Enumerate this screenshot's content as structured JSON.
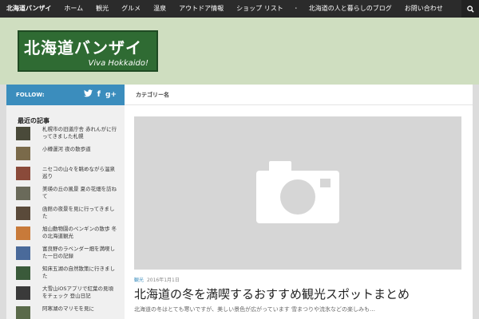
{
  "topnav": {
    "items": [
      "北海道バンザイ",
      "ホーム",
      "観光",
      "グルメ",
      "温泉",
      "アウトドア情報",
      "ショップ リスト",
      "・",
      "北海道の人と暮らしのブログ",
      "お問い合わせ"
    ]
  },
  "header": {
    "logo_jp": "北海道バンザイ",
    "logo_en": "Viva Hokkaido!"
  },
  "sidebar": {
    "follow_label": "FOLLOW:",
    "socials": [
      "twitter-icon",
      "facebook-icon",
      "googleplus-icon"
    ],
    "title": "最近の記事",
    "items": [
      {
        "label": "札幌市の旧道庁舎 赤れんがに行ってきました札幌",
        "color": "#4a4a3a"
      },
      {
        "label": "小樽運河 夜の散歩道",
        "color": "#7a6a4a"
      },
      {
        "label": "ニセコの山々を眺めながら温泉巡り",
        "color": "#8a4a3a"
      },
      {
        "label": "美瑛の丘の風景 夏の花畑を訪ねて",
        "color": "#6a6a5a"
      },
      {
        "label": "函館の夜景を見に行ってきました",
        "color": "#5a4a3a"
      },
      {
        "label": "旭山動物園のペンギンの散歩 冬の北海道観光",
        "color": "#c87a3a"
      },
      {
        "label": "富良野のラベンダー畑を満喫した一日の記録",
        "color": "#4a6a9a"
      },
      {
        "label": "知床五湖の自然散策に行きました",
        "color": "#3a5a3a"
      },
      {
        "label": "大雪山iOSアプリで紅葉の見頃をチェック 登山日記",
        "color": "#3a3a3a"
      },
      {
        "label": "阿寒湖のマリモを見に",
        "color": "#5a6a4a"
      }
    ]
  },
  "main": {
    "breadcrumb": "カテゴリー名",
    "category": "観光",
    "date": "2016年1月1日",
    "post_title": "北海道の冬を満喫するおすすめ観光スポットまとめ",
    "excerpt": "北海道の冬はとても寒いですが、美しい景色が広がっています 雪まつりや流氷などの楽しみも…"
  },
  "colors": {
    "accent": "#3b8dbd",
    "header_bg": "#cfdec0",
    "logo_bg": "#2f6b33",
    "topnav_bg": "#2b2b2b"
  }
}
